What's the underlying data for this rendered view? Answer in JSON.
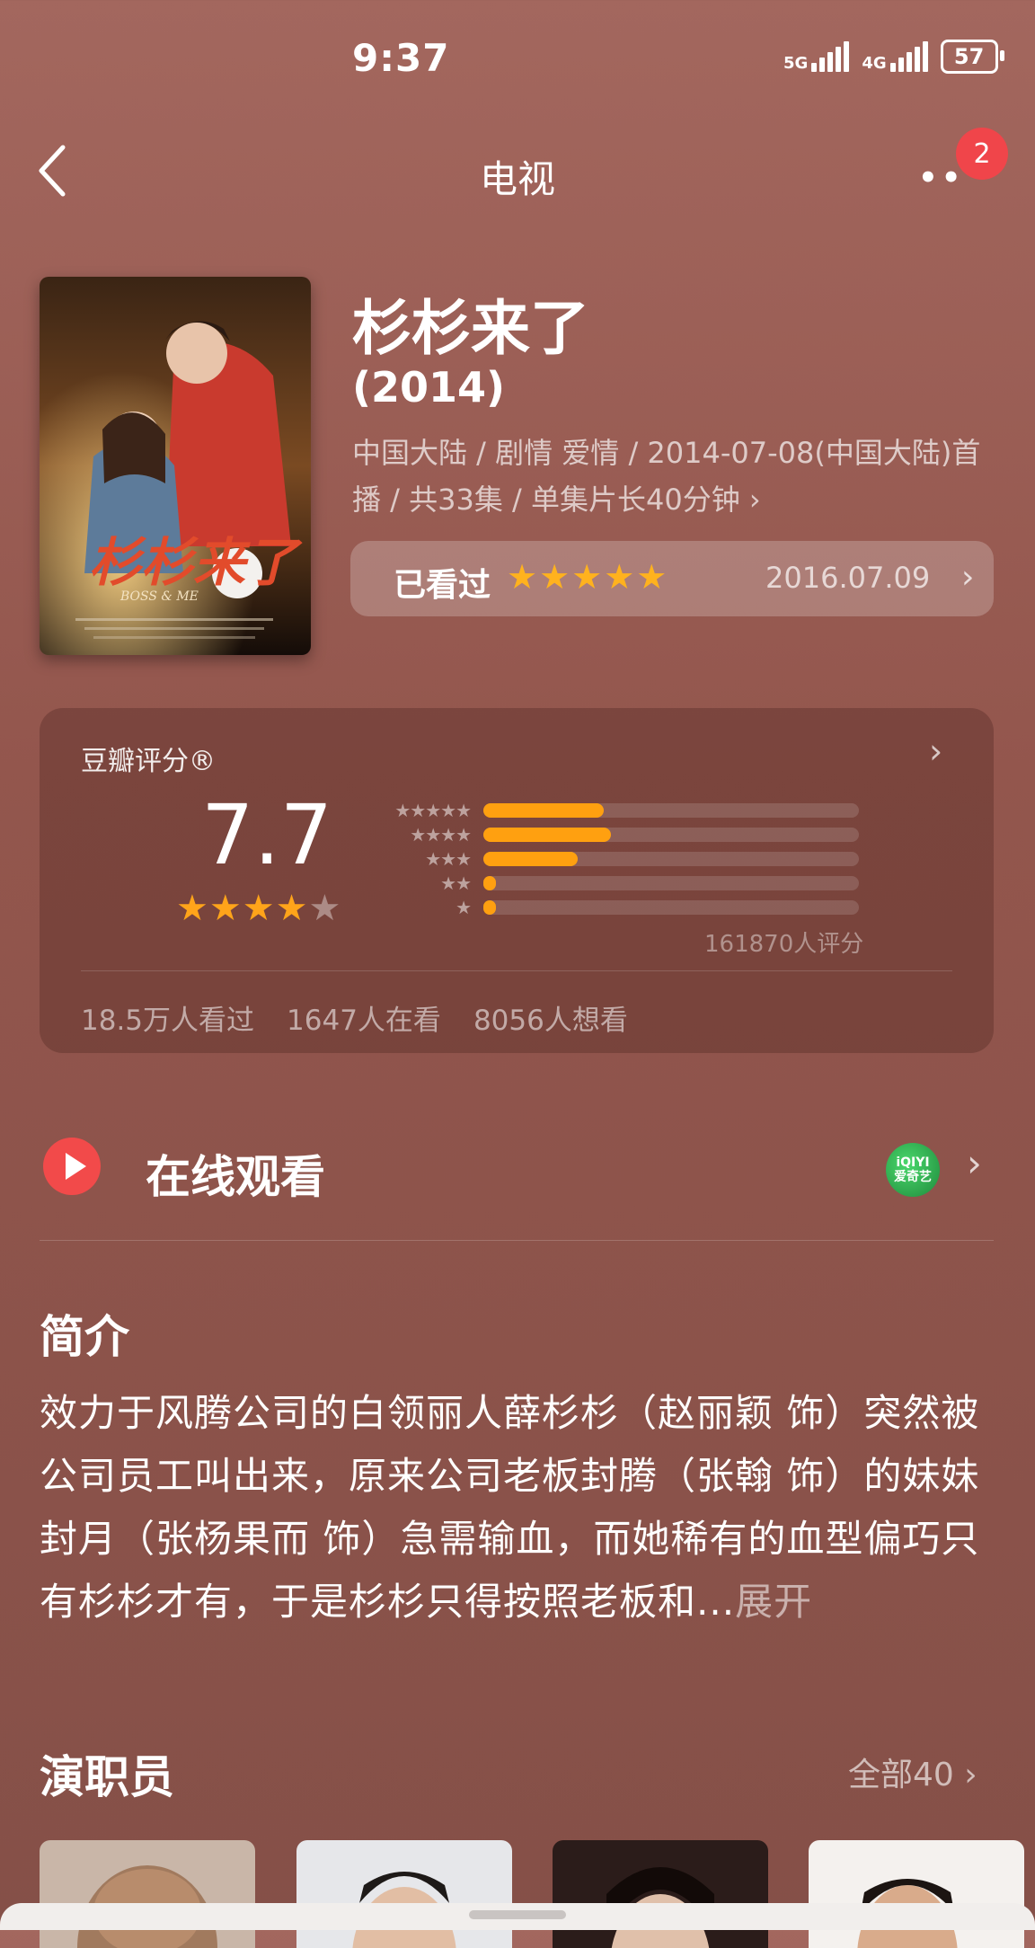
{
  "status_bar": {
    "time": "9:37",
    "net1": "5G",
    "net2": "4G",
    "battery": "57"
  },
  "nav": {
    "title": "电视",
    "more_label": "••",
    "badge": "2"
  },
  "movie": {
    "title": "杉杉来了",
    "year": "(2014)",
    "meta": "中国大陆 / 剧情 爱情 / 2014-07-08(中国大陆)首播 / 共33集 / 单集片长40分钟",
    "meta_chevron": "›",
    "poster_title": "杉杉来了",
    "poster_subtitle": "BOSS & ME"
  },
  "watched": {
    "label": "已看过",
    "stars": "★★★★★",
    "date": "2016.07.09",
    "chevron": "›"
  },
  "rating": {
    "label": "豆瓣评分®",
    "chevron": "›",
    "score": "7.7",
    "stars_on": "★★★★",
    "stars_off": "★",
    "count": "161870人评分",
    "distribution": [
      {
        "stars": "★★★★★",
        "fraction": 0.32
      },
      {
        "stars": "★★★★",
        "fraction": 0.34
      },
      {
        "stars": "★★★",
        "fraction": 0.25
      },
      {
        "stars": "★★",
        "fraction": 0.03
      },
      {
        "stars": "★",
        "fraction": 0.03
      }
    ],
    "stats": [
      "18.5万人看过",
      "1647人在看",
      "8056人想看"
    ]
  },
  "online": {
    "label": "在线观看",
    "provider_top": "iQIYI",
    "provider_bottom": "爱奇艺",
    "chevron": "›"
  },
  "synopsis": {
    "title": "简介",
    "text": "效力于风腾公司的白领丽人薛杉杉（赵丽颖 饰）突然被公司员工叫出来，原来公司老板封腾（张翰 饰）的妹妹封月（张杨果而 饰）急需输血，而她稀有的血型偏巧只有杉杉才有，于是杉杉只得按照老板和...",
    "more": "展开"
  },
  "cast": {
    "title": "演职员",
    "all": "全部40 ›"
  },
  "colors": {
    "accent": "#ffa010",
    "badge": "#f0454a",
    "background": "#9b5f56"
  },
  "icons": [
    "back-icon",
    "more-icon",
    "play-icon",
    "iqiyi-logo",
    "chevron-right-icon",
    "star-icon"
  ]
}
